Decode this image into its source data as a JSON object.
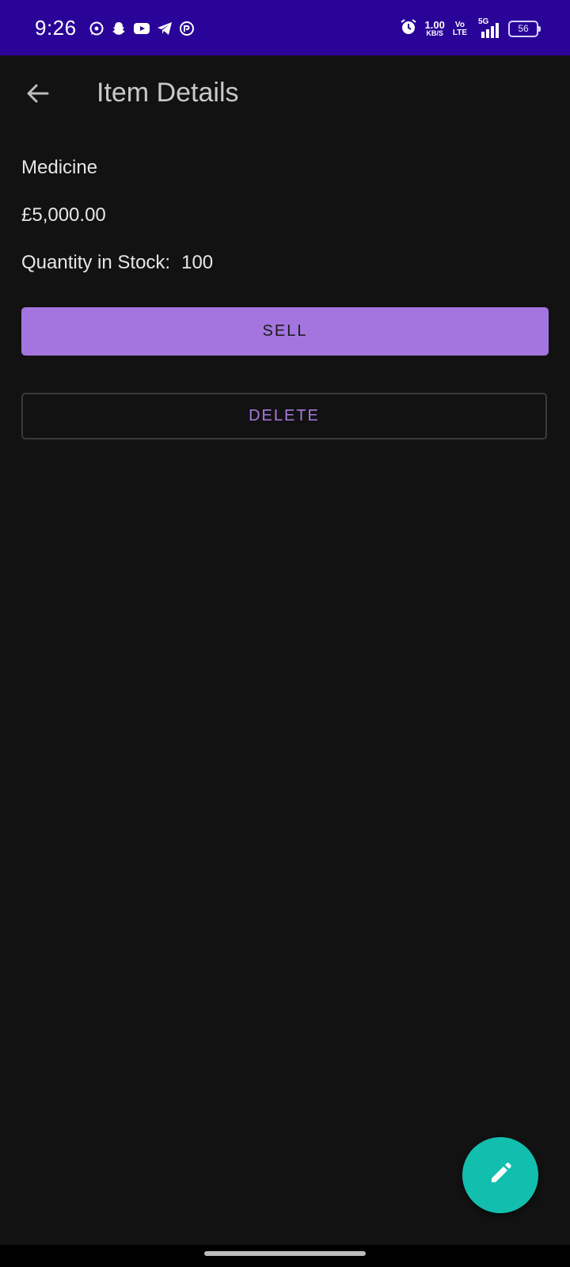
{
  "status_bar": {
    "time": "9:26",
    "net_speed_value": "1.00",
    "net_speed_unit": "KB/S",
    "volte_top": "Vo",
    "volte_bottom": "LTE",
    "signal_label": "5G",
    "battery": "56",
    "left_icons": [
      "whatsapp-icon",
      "snapchat-icon",
      "youtube-icon",
      "telegram-icon",
      "app-icon"
    ],
    "background": "#2a0499"
  },
  "app_bar": {
    "title": "Item Details",
    "back_icon": "arrow-left-icon"
  },
  "item": {
    "name": "Medicine",
    "price": "£5,000.00",
    "stock_label": "Quantity in Stock:",
    "stock_value": "100"
  },
  "actions": {
    "sell_label": "SELL",
    "delete_label": "DELETE"
  },
  "fab": {
    "icon": "edit-pencil-icon",
    "color": "#12bfae"
  },
  "colors": {
    "background": "#121212",
    "primary": "#a575df",
    "accent": "#12bfae"
  }
}
